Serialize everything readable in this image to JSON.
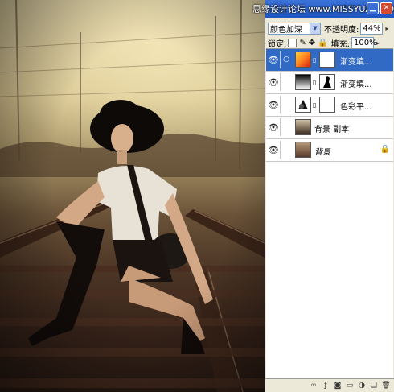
{
  "panel": {
    "title_watermark": "思缘设计论坛 www.MISSYUAN.COM",
    "blend_mode": "颜色加深",
    "opacity_label": "不透明度:",
    "opacity_value": "44%",
    "lock_label": "锁定:",
    "fill_label": "填充:",
    "fill_value": "100%"
  },
  "layers": [
    {
      "name": "渐变填...",
      "active": true
    },
    {
      "name": "渐变填...",
      "active": false
    },
    {
      "name": "色彩平...",
      "active": false
    },
    {
      "name": "背景 副本",
      "active": false
    },
    {
      "name": "背景",
      "active": false
    }
  ],
  "icons": {
    "eye": "eye-icon",
    "lock": "lock-icon",
    "link": "link-icon",
    "close": "close-icon",
    "minimize": "minimize-icon"
  },
  "colors": {
    "active_row": "#316ac5",
    "panel_bg": "#ece9d8",
    "title_bar": "#1f55c2",
    "photo_tone": "#d8c590"
  }
}
